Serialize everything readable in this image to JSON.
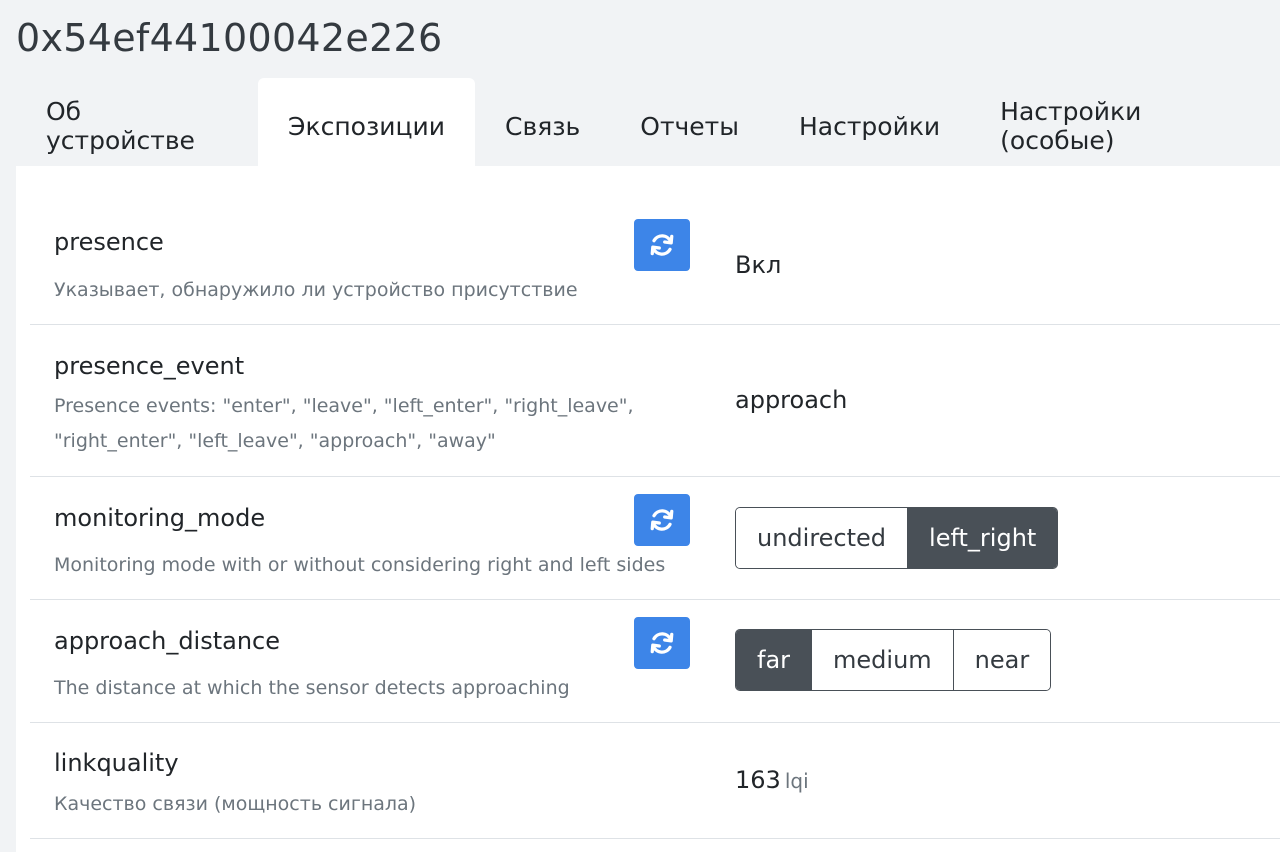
{
  "device": {
    "title": "0x54ef44100042e226"
  },
  "tabs": [
    {
      "label": "Об устройстве",
      "active": false
    },
    {
      "label": "Экспозиции",
      "active": true
    },
    {
      "label": "Связь",
      "active": false
    },
    {
      "label": "Отчеты",
      "active": false
    },
    {
      "label": "Настройки",
      "active": false
    },
    {
      "label": "Настройки (особые)",
      "active": false
    }
  ],
  "exposes": {
    "presence": {
      "name": "presence",
      "description": "Указывает, обнаружило ли устройство присутствие",
      "value": "Вкл"
    },
    "presence_event": {
      "name": "presence_event",
      "description_line1": "Presence events: \"enter\", \"leave\", \"left_enter\", \"right_leave\",",
      "description_line2": "\"right_enter\", \"left_leave\", \"approach\", \"away\"",
      "value": "approach"
    },
    "monitoring_mode": {
      "name": "monitoring_mode",
      "description": "Monitoring mode with or without considering right and left sides",
      "options": [
        "undirected",
        "left_right"
      ],
      "selected": "left_right"
    },
    "approach_distance": {
      "name": "approach_distance",
      "description": "The distance at which the sensor detects approaching",
      "options": [
        "far",
        "medium",
        "near"
      ],
      "selected": "far"
    },
    "linkquality": {
      "name": "linkquality",
      "description": "Качество связи (мощность сигнала)",
      "value": "163",
      "unit": "lqi"
    }
  },
  "icons": {
    "refresh": "refresh-icon"
  },
  "colors": {
    "accent": "#3d85e8",
    "selected": "#495057"
  }
}
